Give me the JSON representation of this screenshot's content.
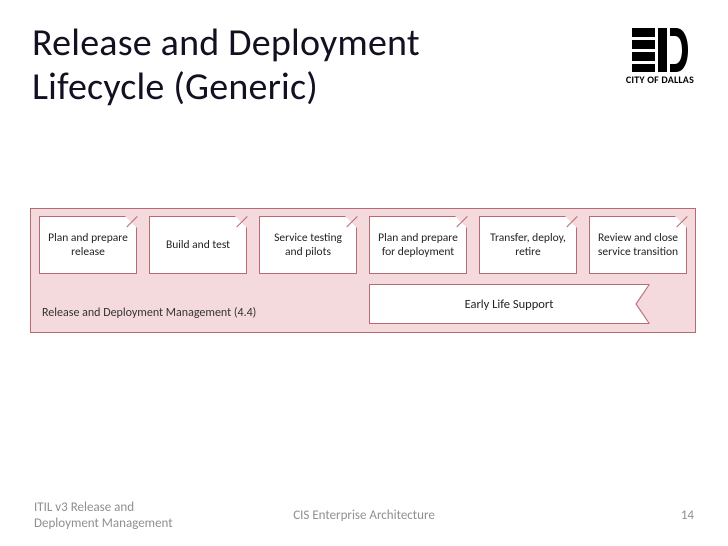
{
  "title_line1": "Release and Deployment",
  "title_line2": "Lifecycle (Generic)",
  "logo_caption": "CITY OF DALLAS",
  "phases": [
    "Plan and prepare release",
    "Build and test",
    "Service testing and pilots",
    "Plan and prepare for deployment",
    "Transfer, deploy, retire",
    "Review and close service transition"
  ],
  "section_label": "Release and Deployment Management (4.4)",
  "early_life": "Early Life Support",
  "footer": {
    "left_line1": "ITIL v3 Release and",
    "left_line2": "Deployment Management",
    "center": "CIS Enterprise Architecture",
    "page": "14"
  }
}
